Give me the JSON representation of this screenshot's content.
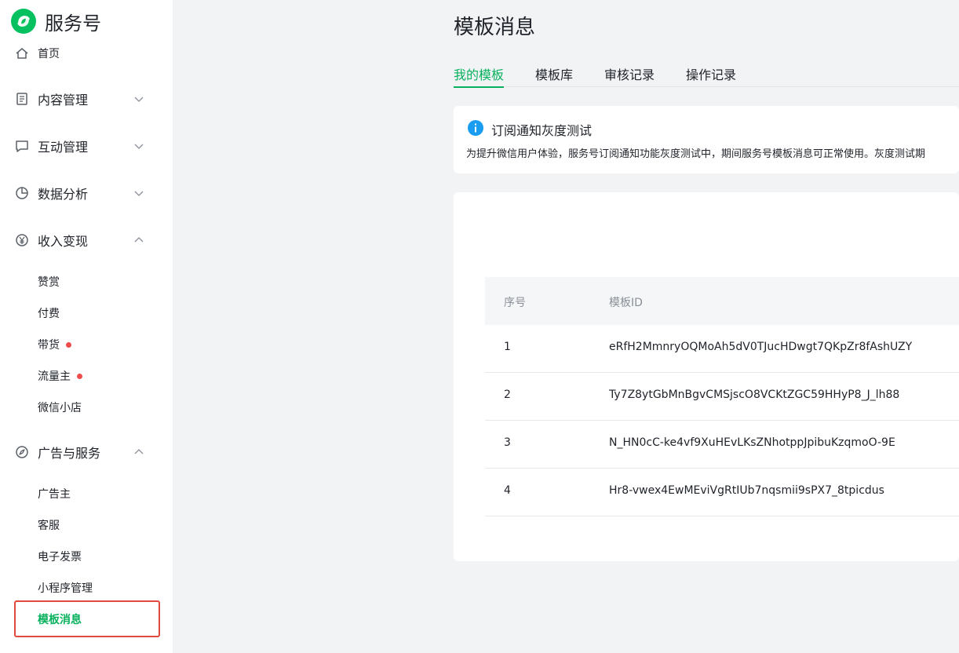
{
  "brand": {
    "title": "服务号"
  },
  "sidebar": {
    "home": "首页",
    "groups": [
      {
        "label": "内容管理",
        "icon": "document-icon",
        "expanded": false
      },
      {
        "label": "互动管理",
        "icon": "chat-icon",
        "expanded": false
      },
      {
        "label": "数据分析",
        "icon": "pie-chart-icon",
        "expanded": false
      },
      {
        "label": "收入变现",
        "icon": "yen-icon",
        "expanded": true
      },
      {
        "label": "广告与服务",
        "icon": "compass-icon",
        "expanded": true
      }
    ],
    "monetize_items": [
      {
        "label": "赞赏",
        "badge": false
      },
      {
        "label": "付费",
        "badge": false
      },
      {
        "label": "带货",
        "badge": true
      },
      {
        "label": "流量主",
        "badge": true
      },
      {
        "label": "微信小店",
        "badge": false
      }
    ],
    "ads_items": [
      {
        "label": "广告主"
      },
      {
        "label": "客服"
      },
      {
        "label": "电子发票"
      },
      {
        "label": "小程序管理"
      },
      {
        "label": "模板消息",
        "active": true
      }
    ]
  },
  "main": {
    "title": "模板消息",
    "tabs": [
      {
        "label": "我的模板",
        "active": true
      },
      {
        "label": "模板库",
        "active": false
      },
      {
        "label": "审核记录",
        "active": false
      },
      {
        "label": "操作记录",
        "active": false
      }
    ],
    "notice": {
      "title": "订阅通知灰度测试",
      "body": "为提升微信用户体验，服务号订阅通知功能灰度测试中，期间服务号模板消息可正常使用。灰度测试期"
    },
    "table": {
      "headers": [
        "序号",
        "模板ID"
      ],
      "rows": [
        [
          "1",
          "eRfH2MmnryOQMoAh5dV0TJucHDwgt7QKpZr8fAshUZY"
        ],
        [
          "2",
          "Ty7Z8ytGbMnBgvCMSjscO8VCKtZGC59HHyP8_J_lh88"
        ],
        [
          "3",
          "N_HN0cC-ke4vf9XuHEvLKsZNhotppJpibuKzqmoO-9E"
        ],
        [
          "4",
          "Hr8-vwex4EwMEviVgRtIUb7nqsmii9sPX7_8tpicdus"
        ]
      ]
    }
  },
  "colors": {
    "accent": "#07b15d",
    "highlight_box": "#e24a3d",
    "badge": "#f04b4b",
    "info": "#1a9cf0"
  }
}
